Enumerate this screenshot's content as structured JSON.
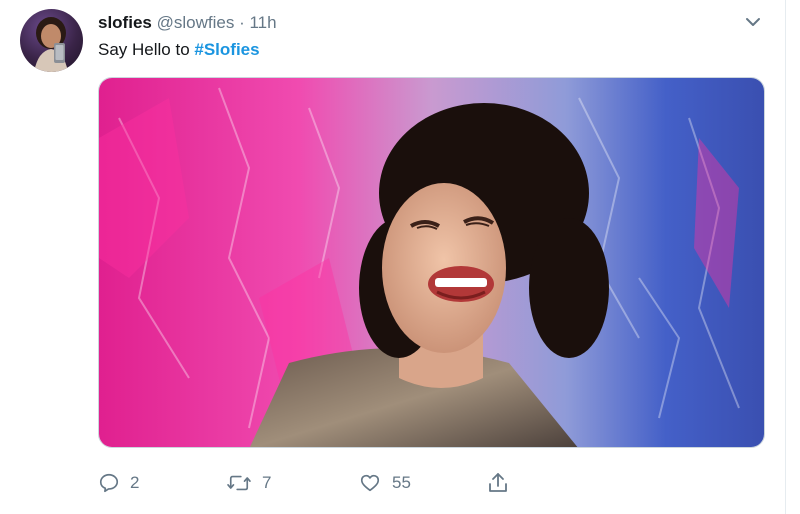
{
  "tweet": {
    "display_name": "slofies",
    "handle": "@slowfies",
    "separator": "·",
    "time": "11h",
    "text_prefix": "Say Hello to ",
    "hashtag": "#Slofies"
  },
  "actions": {
    "reply_count": "2",
    "retweet_count": "7",
    "like_count": "55"
  },
  "icons": {
    "reply": "reply-bubble-icon",
    "retweet": "retweet-arrows-icon",
    "like": "heart-icon",
    "share": "share-upload-icon",
    "more": "chevron-down-icon"
  },
  "colors": {
    "hashtag": "#1b95e0",
    "secondary_text": "#657786",
    "icon": "#657786"
  }
}
